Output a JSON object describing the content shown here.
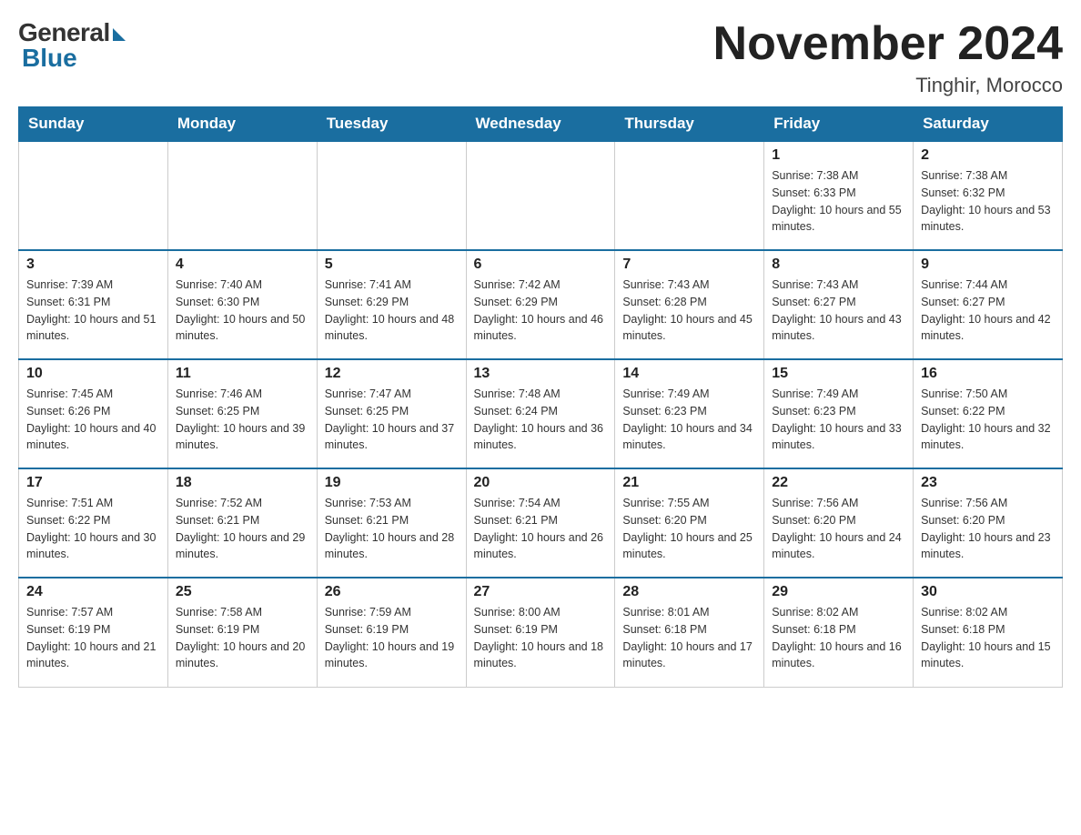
{
  "logo": {
    "general": "General",
    "blue": "Blue"
  },
  "title": "November 2024",
  "location": "Tinghir, Morocco",
  "days_of_week": [
    "Sunday",
    "Monday",
    "Tuesday",
    "Wednesday",
    "Thursday",
    "Friday",
    "Saturday"
  ],
  "weeks": [
    [
      {
        "day": "",
        "info": ""
      },
      {
        "day": "",
        "info": ""
      },
      {
        "day": "",
        "info": ""
      },
      {
        "day": "",
        "info": ""
      },
      {
        "day": "",
        "info": ""
      },
      {
        "day": "1",
        "info": "Sunrise: 7:38 AM\nSunset: 6:33 PM\nDaylight: 10 hours and 55 minutes."
      },
      {
        "day": "2",
        "info": "Sunrise: 7:38 AM\nSunset: 6:32 PM\nDaylight: 10 hours and 53 minutes."
      }
    ],
    [
      {
        "day": "3",
        "info": "Sunrise: 7:39 AM\nSunset: 6:31 PM\nDaylight: 10 hours and 51 minutes."
      },
      {
        "day": "4",
        "info": "Sunrise: 7:40 AM\nSunset: 6:30 PM\nDaylight: 10 hours and 50 minutes."
      },
      {
        "day": "5",
        "info": "Sunrise: 7:41 AM\nSunset: 6:29 PM\nDaylight: 10 hours and 48 minutes."
      },
      {
        "day": "6",
        "info": "Sunrise: 7:42 AM\nSunset: 6:29 PM\nDaylight: 10 hours and 46 minutes."
      },
      {
        "day": "7",
        "info": "Sunrise: 7:43 AM\nSunset: 6:28 PM\nDaylight: 10 hours and 45 minutes."
      },
      {
        "day": "8",
        "info": "Sunrise: 7:43 AM\nSunset: 6:27 PM\nDaylight: 10 hours and 43 minutes."
      },
      {
        "day": "9",
        "info": "Sunrise: 7:44 AM\nSunset: 6:27 PM\nDaylight: 10 hours and 42 minutes."
      }
    ],
    [
      {
        "day": "10",
        "info": "Sunrise: 7:45 AM\nSunset: 6:26 PM\nDaylight: 10 hours and 40 minutes."
      },
      {
        "day": "11",
        "info": "Sunrise: 7:46 AM\nSunset: 6:25 PM\nDaylight: 10 hours and 39 minutes."
      },
      {
        "day": "12",
        "info": "Sunrise: 7:47 AM\nSunset: 6:25 PM\nDaylight: 10 hours and 37 minutes."
      },
      {
        "day": "13",
        "info": "Sunrise: 7:48 AM\nSunset: 6:24 PM\nDaylight: 10 hours and 36 minutes."
      },
      {
        "day": "14",
        "info": "Sunrise: 7:49 AM\nSunset: 6:23 PM\nDaylight: 10 hours and 34 minutes."
      },
      {
        "day": "15",
        "info": "Sunrise: 7:49 AM\nSunset: 6:23 PM\nDaylight: 10 hours and 33 minutes."
      },
      {
        "day": "16",
        "info": "Sunrise: 7:50 AM\nSunset: 6:22 PM\nDaylight: 10 hours and 32 minutes."
      }
    ],
    [
      {
        "day": "17",
        "info": "Sunrise: 7:51 AM\nSunset: 6:22 PM\nDaylight: 10 hours and 30 minutes."
      },
      {
        "day": "18",
        "info": "Sunrise: 7:52 AM\nSunset: 6:21 PM\nDaylight: 10 hours and 29 minutes."
      },
      {
        "day": "19",
        "info": "Sunrise: 7:53 AM\nSunset: 6:21 PM\nDaylight: 10 hours and 28 minutes."
      },
      {
        "day": "20",
        "info": "Sunrise: 7:54 AM\nSunset: 6:21 PM\nDaylight: 10 hours and 26 minutes."
      },
      {
        "day": "21",
        "info": "Sunrise: 7:55 AM\nSunset: 6:20 PM\nDaylight: 10 hours and 25 minutes."
      },
      {
        "day": "22",
        "info": "Sunrise: 7:56 AM\nSunset: 6:20 PM\nDaylight: 10 hours and 24 minutes."
      },
      {
        "day": "23",
        "info": "Sunrise: 7:56 AM\nSunset: 6:20 PM\nDaylight: 10 hours and 23 minutes."
      }
    ],
    [
      {
        "day": "24",
        "info": "Sunrise: 7:57 AM\nSunset: 6:19 PM\nDaylight: 10 hours and 21 minutes."
      },
      {
        "day": "25",
        "info": "Sunrise: 7:58 AM\nSunset: 6:19 PM\nDaylight: 10 hours and 20 minutes."
      },
      {
        "day": "26",
        "info": "Sunrise: 7:59 AM\nSunset: 6:19 PM\nDaylight: 10 hours and 19 minutes."
      },
      {
        "day": "27",
        "info": "Sunrise: 8:00 AM\nSunset: 6:19 PM\nDaylight: 10 hours and 18 minutes."
      },
      {
        "day": "28",
        "info": "Sunrise: 8:01 AM\nSunset: 6:18 PM\nDaylight: 10 hours and 17 minutes."
      },
      {
        "day": "29",
        "info": "Sunrise: 8:02 AM\nSunset: 6:18 PM\nDaylight: 10 hours and 16 minutes."
      },
      {
        "day": "30",
        "info": "Sunrise: 8:02 AM\nSunset: 6:18 PM\nDaylight: 10 hours and 15 minutes."
      }
    ]
  ]
}
